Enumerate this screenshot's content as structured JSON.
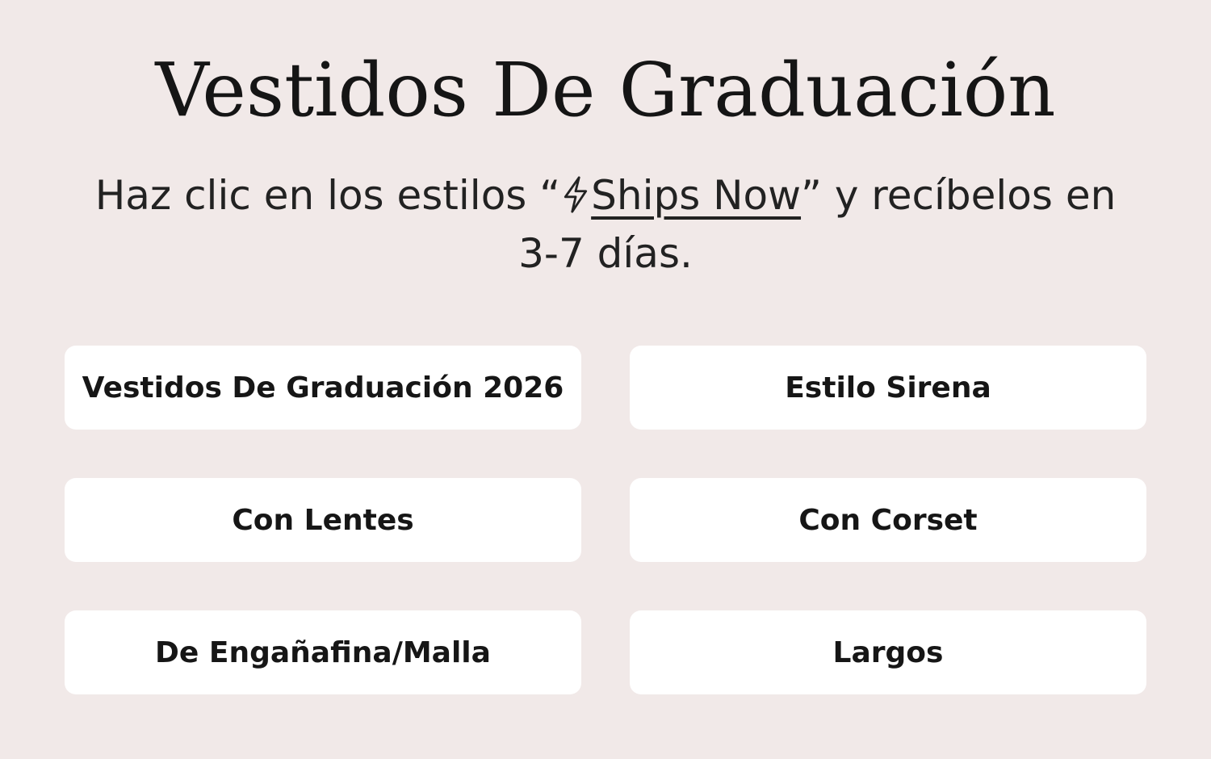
{
  "header": {
    "title": "Vestidos De Graduación"
  },
  "subtitle": {
    "before": "Haz clic en los estilos “",
    "link": "Ships Now",
    "after": "” y recíbelos en 3-7 días.",
    "icon": "lightning-bolt-icon"
  },
  "categories": [
    {
      "label": "Vestidos De Graduación 2026"
    },
    {
      "label": "Estilo Sirena"
    },
    {
      "label": "Con Lentes"
    },
    {
      "label": "Con Corset"
    },
    {
      "label": "De Engañafina/Malla"
    },
    {
      "label": "Largos"
    }
  ],
  "colors": {
    "background": "#f1e9e8",
    "card": "#ffffff",
    "text": "#1a1a1a"
  }
}
